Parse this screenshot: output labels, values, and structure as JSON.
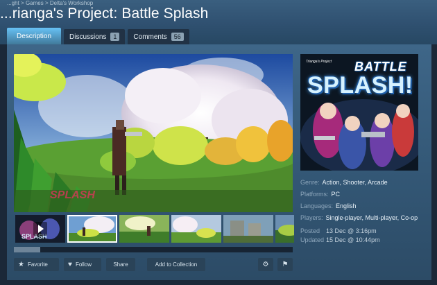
{
  "breadcrumb": [
    "...ght",
    "Games",
    "Delta's Workshop"
  ],
  "app": {
    "title": "...rianga's Project: Battle Splash"
  },
  "tabs": [
    {
      "label": "Description",
      "active": true
    },
    {
      "label": "Discussions",
      "count": "1"
    },
    {
      "label": "Comments",
      "count": "56"
    }
  ],
  "media": {
    "main_icon": "screenshot-image",
    "thumbnails": 6,
    "selected_thumbnail": 1,
    "scroll_position": 0.1
  },
  "cover": {
    "small_title": "Trianga's Project",
    "battle_text": "BATTLE",
    "splash_text": "SPLASH!"
  },
  "info": {
    "genre_label": "Genre:",
    "genre_values": "Action, Shooter, Arcade",
    "platforms_label": "Platforms:",
    "platforms_values": "PC",
    "languages_label": "Languages:",
    "languages_values": "English",
    "players_label": "Players:",
    "players_values": "Single-player, Multi-player, Co-op"
  },
  "dates": {
    "posted_label": "Posted",
    "posted_value": "13 Dec @ 3:16pm",
    "updated_label": "Updated",
    "updated_value": "15 Dec @ 10:44pm"
  },
  "actions": {
    "favorite_label": "Favorite",
    "follow_label": "Follow",
    "share_label": "Share",
    "add_collection_label": "Add to Collection"
  },
  "colors": {
    "background": "#1b2838",
    "panel": "#355a79",
    "tab_active": "#67c1f5",
    "label_text": "#8ea7bc"
  }
}
